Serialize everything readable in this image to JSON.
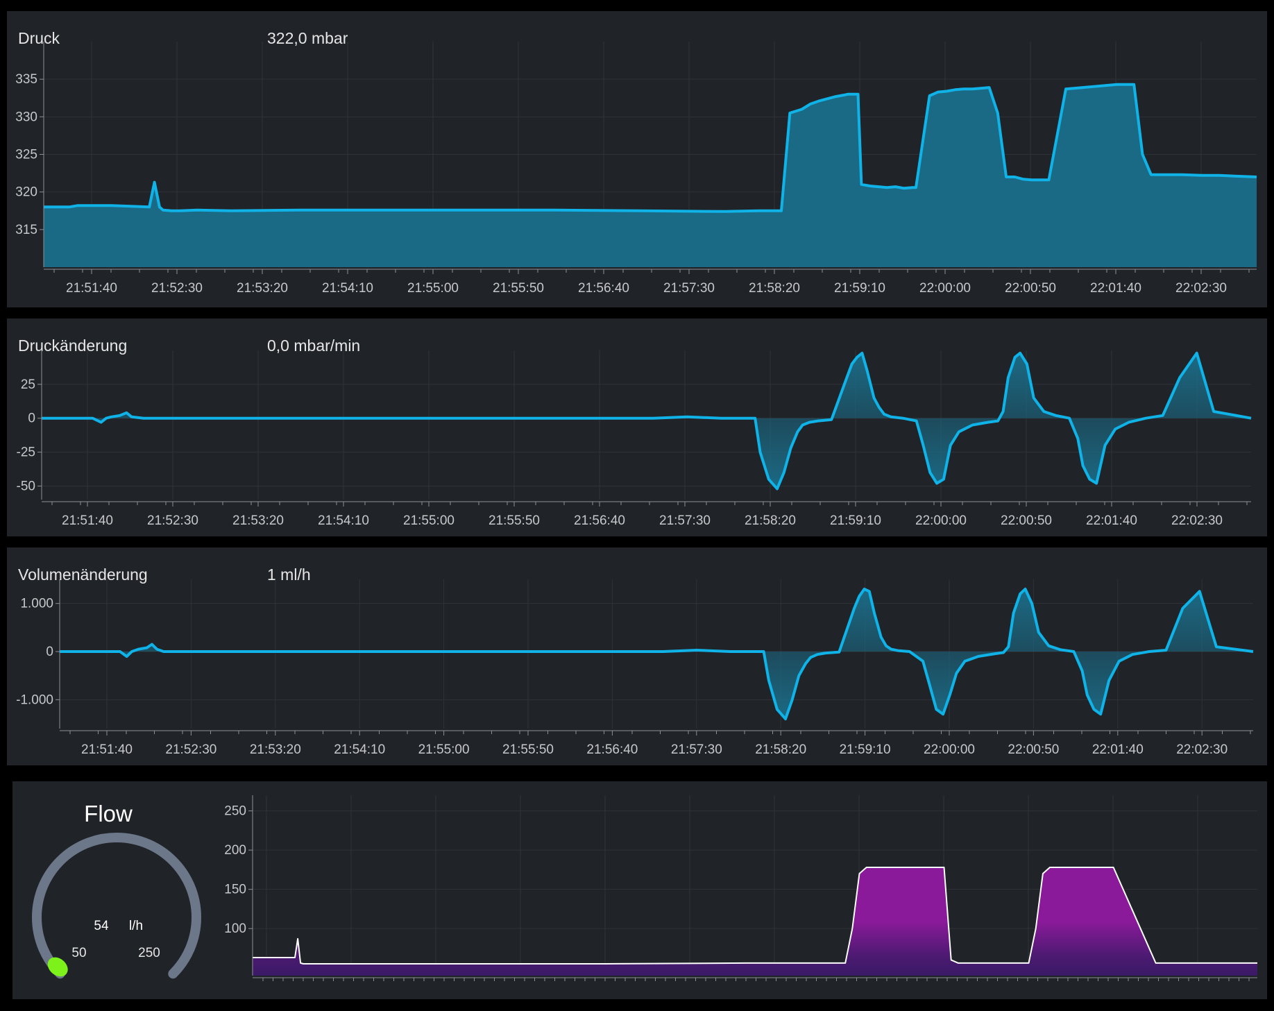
{
  "colors": {
    "background": "#000000",
    "panel": "#202328",
    "grid": "#2f3338",
    "axis": "#8e9094",
    "line_blue": "#10b3e8",
    "fill_blue": "#1b6a85",
    "line_flow": "#ffffff",
    "fill_flow": "#8a1a99",
    "gauge_track": "#6c7789",
    "gauge_marker": "#7cf21a"
  },
  "panels": [
    {
      "title": "Druck",
      "current_value": "322,0 mbar"
    },
    {
      "title": "Druckänderung",
      "current_value": "0,0 mbar/min"
    },
    {
      "title": "Volumenänderung",
      "current_value": "1 ml/h"
    }
  ],
  "gauge": {
    "title": "Flow",
    "value": "54",
    "unit": "l/h",
    "min_label": "50",
    "max_label": "250",
    "icon": "gauge-ring"
  },
  "chart_data": [
    {
      "type": "area",
      "title": "Druck",
      "x_ticks": [
        "21:51:40",
        "21:52:30",
        "21:53:20",
        "21:54:10",
        "21:55:00",
        "21:55:50",
        "21:56:40",
        "21:57:30",
        "21:58:20",
        "21:59:10",
        "22:00:00",
        "22:00:50",
        "22:01:40",
        "22:02:30"
      ],
      "y_ticks": [
        "315",
        "320",
        "325",
        "330",
        "335"
      ],
      "ylim": [
        310,
        340
      ],
      "xlim": [
        0,
        712
      ],
      "series": [
        {
          "x": [
            0,
            15,
            20,
            40,
            62,
            65,
            68,
            70,
            75,
            80,
            90,
            110,
            150,
            200,
            250,
            300,
            350,
            400,
            420,
            430,
            433,
            438,
            445,
            450,
            455,
            460,
            465,
            470,
            472,
            478,
            480,
            485,
            490,
            495,
            500,
            505,
            510,
            512,
            520,
            525,
            530,
            535,
            540,
            545,
            550,
            555,
            560,
            565,
            570,
            575,
            580,
            585,
            590,
            600,
            610,
            630,
            640,
            645,
            650,
            658,
            668,
            680,
            690,
            700,
            712
          ],
          "y": [
            318.0,
            318.0,
            318.2,
            318.2,
            318.0,
            321.3,
            318.0,
            317.6,
            317.5,
            317.5,
            317.6,
            317.5,
            317.6,
            317.6,
            317.6,
            317.6,
            317.5,
            317.4,
            317.5,
            317.5,
            317.5,
            330.5,
            331.0,
            331.7,
            332.1,
            332.4,
            332.7,
            332.9,
            333.0,
            333.0,
            321.0,
            320.8,
            320.7,
            320.6,
            320.7,
            320.5,
            320.6,
            320.6,
            332.8,
            333.3,
            333.4,
            333.6,
            333.7,
            333.7,
            333.8,
            333.9,
            330.5,
            322.0,
            322.0,
            321.7,
            321.6,
            321.6,
            321.6,
            333.7,
            333.9,
            334.3,
            334.3,
            325.0,
            322.3,
            322.3,
            322.3,
            322.2,
            322.2,
            322.1,
            322.0
          ]
        }
      ]
    },
    {
      "type": "area",
      "title": "Druckänderung",
      "x_ticks": [
        "21:51:40",
        "21:52:30",
        "21:53:20",
        "21:54:10",
        "21:55:00",
        "21:55:50",
        "21:56:40",
        "21:57:30",
        "21:58:20",
        "21:59:10",
        "22:00:00",
        "22:00:50",
        "22:01:40",
        "22:02:30"
      ],
      "y_ticks": [
        "25",
        "0",
        "-25",
        "-50"
      ],
      "ylim": [
        -60,
        50
      ],
      "xlim": [
        0,
        712
      ],
      "series": [
        {
          "x": [
            0,
            30,
            35,
            38,
            41,
            46,
            50,
            53,
            60,
            100,
            200,
            300,
            360,
            380,
            400,
            420,
            423,
            428,
            433,
            437,
            441,
            445,
            448,
            452,
            457,
            465,
            474,
            477,
            480,
            483,
            486,
            490,
            493,
            496,
            500,
            507,
            515,
            519,
            523,
            527,
            531,
            535,
            540,
            548,
            557,
            563,
            566,
            569,
            573,
            576,
            580,
            584,
            590,
            597,
            605,
            610,
            613,
            617,
            621,
            626,
            632,
            640,
            650,
            660,
            670,
            680,
            690,
            712
          ],
          "y": [
            0,
            0,
            -3,
            0,
            1,
            2,
            4,
            1,
            0,
            0,
            0,
            0,
            0,
            1,
            0,
            0,
            -25,
            -45,
            -52,
            -40,
            -22,
            -10,
            -5,
            -3,
            -2,
            -1,
            30,
            40,
            45,
            48,
            35,
            15,
            8,
            3,
            1,
            0,
            -2,
            -20,
            -40,
            -48,
            -45,
            -20,
            -10,
            -5,
            -3,
            -2,
            5,
            30,
            45,
            48,
            40,
            15,
            5,
            2,
            0,
            -15,
            -35,
            -45,
            -48,
            -20,
            -8,
            -3,
            0,
            2,
            30,
            48,
            5,
            0
          ]
        }
      ]
    },
    {
      "type": "area",
      "title": "Volumenänderung",
      "x_ticks": [
        "21:51:40",
        "21:52:30",
        "21:53:20",
        "21:54:10",
        "21:55:00",
        "21:55:50",
        "21:56:40",
        "21:57:30",
        "21:58:20",
        "21:59:10",
        "22:00:00",
        "22:00:50",
        "22:01:40",
        "22:02:30"
      ],
      "y_ticks": [
        "1.000",
        "0",
        "-1.000"
      ],
      "ylim": [
        -1600,
        1500
      ],
      "xlim": [
        0,
        712
      ],
      "series": [
        {
          "x": [
            0,
            36,
            40,
            43,
            47,
            52,
            55,
            58,
            62,
            100,
            200,
            300,
            360,
            380,
            400,
            420,
            423,
            428,
            433,
            437,
            441,
            445,
            448,
            452,
            457,
            465,
            474,
            477,
            480,
            483,
            486,
            490,
            493,
            496,
            500,
            507,
            515,
            519,
            523,
            527,
            531,
            535,
            540,
            548,
            557,
            563,
            566,
            569,
            573,
            576,
            580,
            584,
            590,
            597,
            605,
            610,
            613,
            617,
            621,
            626,
            632,
            640,
            650,
            660,
            670,
            680,
            690,
            712
          ],
          "y": [
            0,
            0,
            -100,
            0,
            50,
            80,
            150,
            50,
            0,
            0,
            0,
            0,
            0,
            30,
            0,
            0,
            -600,
            -1200,
            -1400,
            -1000,
            -500,
            -250,
            -120,
            -60,
            -30,
            -10,
            900,
            1150,
            1300,
            1250,
            800,
            300,
            120,
            50,
            20,
            0,
            -200,
            -700,
            -1200,
            -1300,
            -900,
            -450,
            -200,
            -100,
            -50,
            -20,
            100,
            800,
            1200,
            1300,
            1000,
            400,
            120,
            40,
            0,
            -400,
            -900,
            -1200,
            -1300,
            -600,
            -200,
            -60,
            0,
            30,
            900,
            1250,
            100,
            0
          ]
        }
      ]
    },
    {
      "type": "area",
      "title": "",
      "y_ticks": [
        "250",
        "200",
        "150",
        "100"
      ],
      "ylim": [
        40,
        270
      ],
      "xlim": [
        0,
        712
      ],
      "series": [
        {
          "x": [
            0,
            20,
            30,
            32,
            34,
            36,
            40,
            80,
            150,
            250,
            350,
            400,
            420,
            425,
            430,
            435,
            440,
            450,
            455,
            460,
            465,
            470,
            490,
            495,
            500,
            505,
            510,
            520,
            530,
            540,
            545,
            550,
            555,
            560,
            565,
            570,
            580,
            590,
            595,
            600,
            610,
            640,
            712
          ],
          "y": [
            63,
            63,
            63,
            87,
            56,
            55,
            55,
            55,
            55,
            55,
            56,
            56,
            56,
            100,
            170,
            178,
            178,
            178,
            178,
            178,
            178,
            178,
            178,
            60,
            56,
            56,
            56,
            56,
            56,
            56,
            56,
            56,
            100,
            170,
            178,
            178,
            178,
            178,
            178,
            178,
            178,
            56,
            56
          ]
        }
      ]
    }
  ]
}
